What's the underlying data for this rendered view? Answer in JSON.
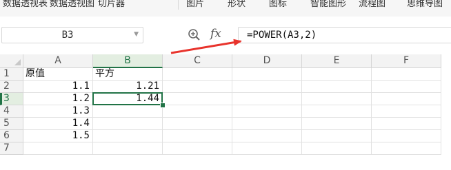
{
  "ribbon": {
    "items": [
      "数据透视表",
      "数据透视图",
      "切片器",
      "图片",
      "形状",
      "图标",
      "智能图形",
      "流程图",
      "思维导图"
    ]
  },
  "formula_bar": {
    "name_box": "B3",
    "fx_label": "fx",
    "formula": "=POWER(A3,2)"
  },
  "sheet": {
    "columns": [
      "A",
      "B",
      "C",
      "D",
      "E",
      "F"
    ],
    "active_column": "B",
    "rows": [
      "1",
      "2",
      "3",
      "4",
      "5",
      "6",
      "7"
    ],
    "active_row": "3",
    "cells": {
      "A1": "原值",
      "B1": "平方",
      "A2": "1.1",
      "B2": "1.21",
      "A3": "1.2",
      "B3": "1.44",
      "A4": "1.3",
      "A5": "1.4",
      "A6": "1.5"
    },
    "selected_cell": "B3"
  },
  "colors": {
    "accent": "#217346",
    "annotation_arrow": "#e8332c"
  }
}
